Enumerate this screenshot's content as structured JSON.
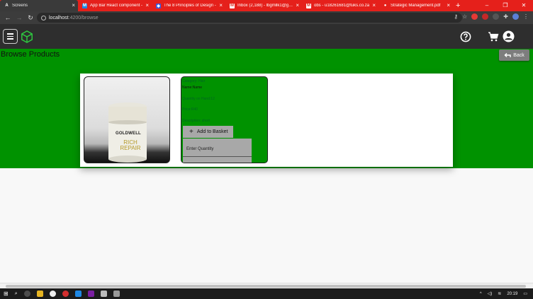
{
  "browser": {
    "tabs": [
      {
        "title": "Screens",
        "active": true,
        "favicon": "A"
      },
      {
        "title": "App Bar React component -",
        "active": false,
        "favicon": "M"
      },
      {
        "title": "The 8 Principles of Design -",
        "active": false,
        "favicon": "◆"
      },
      {
        "title": "Inbox (2,188) - lbgmllk1@gm...",
        "active": false,
        "favicon": "M"
      },
      {
        "title": "obs - u18261681@tuks.co.za",
        "active": false,
        "favicon": "M"
      },
      {
        "title": "Strategic Management.pdf",
        "active": false,
        "favicon": "●"
      }
    ],
    "new_tab": "+",
    "url_host": "localhost",
    "url_path": ":4200/browse"
  },
  "app": {
    "icons": [
      "menu-icon",
      "cube-logo-icon",
      "help-icon",
      "cart-icon",
      "account-icon"
    ],
    "colors": {
      "page_bg": "#009200",
      "toolbar": "#2e2e2e",
      "card": "#ffffff",
      "button": "#a8a8a8"
    }
  },
  "page": {
    "title": "Browse Products",
    "back_label": "Back"
  },
  "product": {
    "image_brand": "GOLDWELL",
    "image_name": "RICH REPAIR",
    "category": "Category: Hair",
    "name": "Name:Name",
    "quantity": "Quantity on Hand:12",
    "price": "Price:R40",
    "description": "Description: short",
    "add_button": "Add to Basket",
    "qty_placeholder": "Enter Quantity"
  },
  "taskbar": {
    "time": "20:19"
  }
}
